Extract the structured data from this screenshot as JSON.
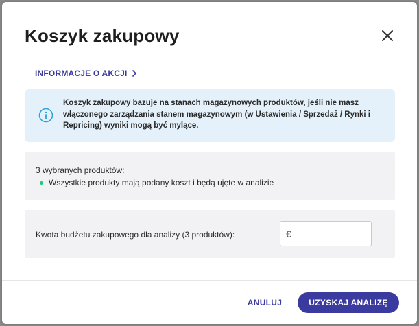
{
  "dialog": {
    "title": "Koszyk zakupowy",
    "close_icon": "close-icon"
  },
  "info_link": {
    "label": "INFORMACJE O AKCJI",
    "icon": "chevron-right-icon"
  },
  "alert": {
    "icon": "info-icon",
    "text": "Koszyk zakupowy bazuje na stanach magazynowych produktów, jeśli nie masz włączonego zarządzania stanem magazynowym (w Ustawienia / Sprzedaż / Rynki i Repricing) wyniki mogą być mylące."
  },
  "products": {
    "count_text": "3 wybranych produktów:",
    "status_text": "Wszystkie produkty mają podany koszt i będą ujęte w analizie",
    "status_color": "#1ec77a"
  },
  "budget": {
    "label": "Kwota budżetu zakupowego dla analizy (3 produktów):",
    "currency": "€",
    "value": ""
  },
  "footer": {
    "cancel_label": "ANULUJ",
    "submit_label": "UZYSKAJ ANALIZĘ"
  },
  "colors": {
    "accent": "#3b3a9e",
    "alert_bg": "#e4f1fa",
    "alert_icon": "#2aa3d8",
    "panel_bg": "#f2f2f4"
  }
}
